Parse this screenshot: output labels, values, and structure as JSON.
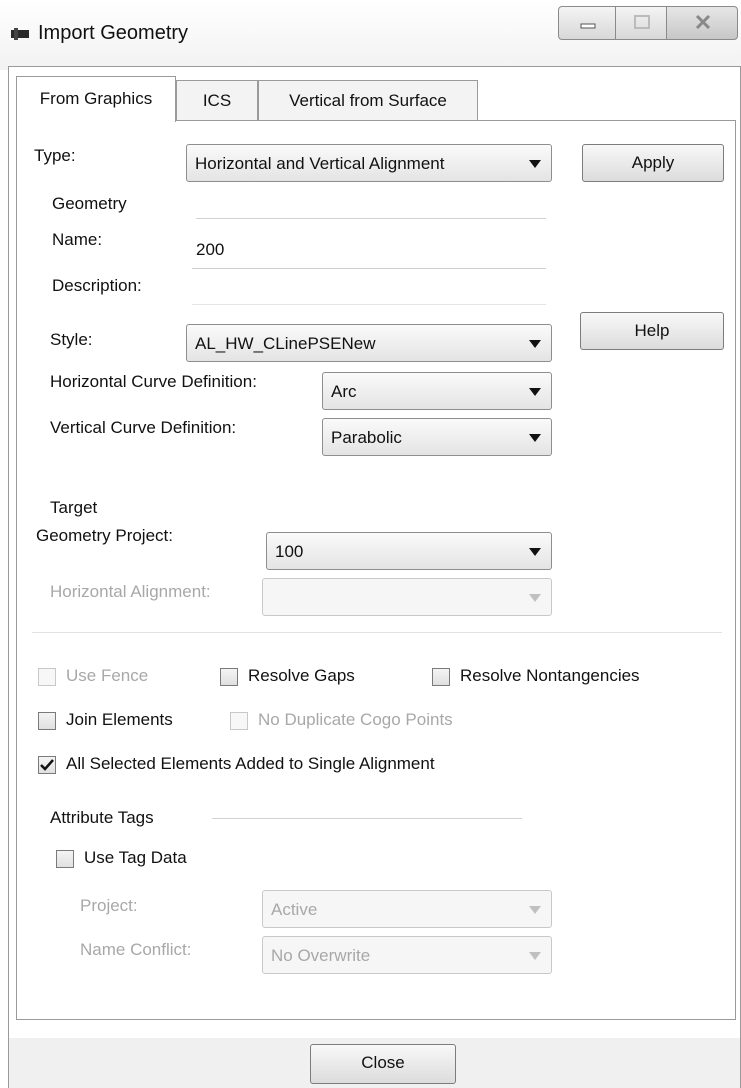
{
  "window": {
    "title": "Import Geometry"
  },
  "tabs": [
    {
      "label": "From Graphics",
      "active": true
    },
    {
      "label": "ICS",
      "active": false
    },
    {
      "label": "Vertical from Surface",
      "active": false
    }
  ],
  "type": {
    "label": "Type:",
    "value": "Horizontal and Vertical Alignment"
  },
  "buttons": {
    "apply": "Apply",
    "help": "Help",
    "close": "Close"
  },
  "geometry": {
    "group_label": "Geometry",
    "name_label": "Name:",
    "name_value": "200",
    "description_label": "Description:",
    "style_label": "Style:",
    "style_value": "AL_HW_CLinePSENew",
    "hcurve_label": "Horizontal Curve Definition:",
    "hcurve_value": "Arc",
    "vcurve_label": "Vertical Curve Definition:",
    "vcurve_value": "Parabolic"
  },
  "target": {
    "group_label": "Target",
    "project_label": "Geometry Project:",
    "project_value": "100",
    "halign_label": "Horizontal Alignment:",
    "halign_value": ""
  },
  "options": {
    "use_fence": {
      "label": "Use Fence",
      "checked": false,
      "enabled": false
    },
    "resolve_gaps": {
      "label": "Resolve Gaps",
      "checked": false,
      "enabled": true
    },
    "resolve_nontangencies": {
      "label": "Resolve Nontangencies",
      "checked": false,
      "enabled": true
    },
    "join_elements": {
      "label": "Join Elements",
      "checked": false,
      "enabled": true
    },
    "no_duplicate_cogo": {
      "label": "No Duplicate Cogo Points",
      "checked": false,
      "enabled": false
    },
    "all_selected": {
      "label": "All Selected Elements Added to Single Alignment",
      "checked": true,
      "enabled": true
    }
  },
  "attribute_tags": {
    "group_label": "Attribute Tags",
    "use_tag_data": {
      "label": "Use Tag Data",
      "checked": false
    },
    "project_label": "Project:",
    "project_value": "Active",
    "name_conflict_label": "Name Conflict:",
    "name_conflict_value": "No Overwrite"
  },
  "icons": {
    "window": "app-icon",
    "minimize": "minimize-icon",
    "maximize": "maximize-icon",
    "close": "close-icon",
    "dropdown": "chevron-down-icon",
    "check": "check-icon"
  }
}
